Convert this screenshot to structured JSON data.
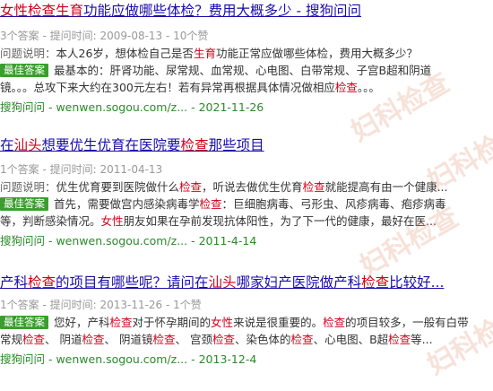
{
  "results": [
    {
      "title": [
        {
          "t": "女性",
          "hl": true
        },
        {
          "t": "检查",
          "hl": true
        },
        {
          "t": "生育",
          "hl": true
        },
        {
          "t": "功能应做哪些体检？费用大概多少 - 搜狗问问",
          "hl": false
        }
      ],
      "meta": "3个答案 - 提问时间: 2009-08-13 - 10个赞",
      "question_label": "问题说明：",
      "question": [
        {
          "t": "本人26岁，想体检自己是否",
          "hl": false
        },
        {
          "t": "生育",
          "hl": true
        },
        {
          "t": "功能正常应做哪些体检，费用大概多少？",
          "hl": false
        }
      ],
      "badge": "最佳答案",
      "answer_lines": [
        [
          {
            "t": "最基本的：肝肾功能、尿常规、血常规、心电图、白带常规、子宫B超和阴道",
            "hl": false
          }
        ],
        [
          {
            "t": "镜。。。总攻下来大约在300元左右！若有异常再根据具体情况做相应",
            "hl": false
          },
          {
            "t": "检查",
            "hl": true
          },
          {
            "t": "。。。",
            "hl": false
          }
        ]
      ],
      "source": "搜狗问问 - wenwen.sogou.com/z... - 2021-11-26"
    },
    {
      "title": [
        {
          "t": "在",
          "hl": false
        },
        {
          "t": "汕头",
          "hl": true
        },
        {
          "t": "想要优生优育在医院要",
          "hl": false
        },
        {
          "t": "检查",
          "hl": true
        },
        {
          "t": "那些项目",
          "hl": false
        }
      ],
      "meta": "1个答案 - 提问时间: 2011-04-13",
      "question_label": "问题说明：",
      "question": [
        {
          "t": "优生优育要到医院做什么",
          "hl": false
        },
        {
          "t": "检查",
          "hl": true
        },
        {
          "t": "，听说去做优生优育",
          "hl": false
        },
        {
          "t": "检查",
          "hl": true
        },
        {
          "t": "就能提高有由一个健康...",
          "hl": false
        }
      ],
      "badge": "最佳答案",
      "answer_lines": [
        [
          {
            "t": "首先，需要做宫内感染病毒学",
            "hl": false
          },
          {
            "t": "检查",
            "hl": true
          },
          {
            "t": "：巨细胞病毒、弓形虫、风疹病毒、疱疹病毒",
            "hl": false
          }
        ],
        [
          {
            "t": "等，判断感染情况。",
            "hl": false
          },
          {
            "t": "女性",
            "hl": true
          },
          {
            "t": "朋友如果在孕前发现抗体阳性，为了下一代的健康，最好在医...",
            "hl": false
          }
        ]
      ],
      "source": "搜狗问问 - wenwen.sogou.com/z... - 2011-4-14"
    },
    {
      "title": [
        {
          "t": "产科",
          "hl": false
        },
        {
          "t": "检查",
          "hl": true
        },
        {
          "t": "的项目有哪些呢？请问在",
          "hl": false
        },
        {
          "t": "汕头",
          "hl": true
        },
        {
          "t": "哪家妇产医院做产科",
          "hl": false
        },
        {
          "t": "检查",
          "hl": true
        },
        {
          "t": "比较好...",
          "hl": false
        }
      ],
      "meta": "1个答案 - 提问时间: 2013-11-26 - 1个赞",
      "badge": "最佳答案",
      "answer_lines": [
        [
          {
            "t": "您好，产科",
            "hl": false
          },
          {
            "t": "检查",
            "hl": true
          },
          {
            "t": "对于怀孕期间的",
            "hl": false
          },
          {
            "t": "女性",
            "hl": true
          },
          {
            "t": "来说是很重要的。",
            "hl": false
          },
          {
            "t": "检查",
            "hl": true
          },
          {
            "t": "的项目较多，一般有白带",
            "hl": false
          }
        ],
        [
          {
            "t": "常规",
            "hl": false
          },
          {
            "t": "检查",
            "hl": true
          },
          {
            "t": "、 阴道",
            "hl": false
          },
          {
            "t": "检查",
            "hl": true
          },
          {
            "t": "、 阴道镜",
            "hl": false
          },
          {
            "t": "检查",
            "hl": true
          },
          {
            "t": "、 宫颈",
            "hl": false
          },
          {
            "t": "检查",
            "hl": true
          },
          {
            "t": "、染色体的",
            "hl": false
          },
          {
            "t": "检查",
            "hl": true
          },
          {
            "t": "、心电图、B超",
            "hl": false
          },
          {
            "t": "检查",
            "hl": true
          },
          {
            "t": "等...",
            "hl": false
          }
        ]
      ],
      "source": "搜狗问问 - wenwen.sogou.com/z... - 2013-12-4"
    }
  ],
  "watermark": "妇科检查"
}
